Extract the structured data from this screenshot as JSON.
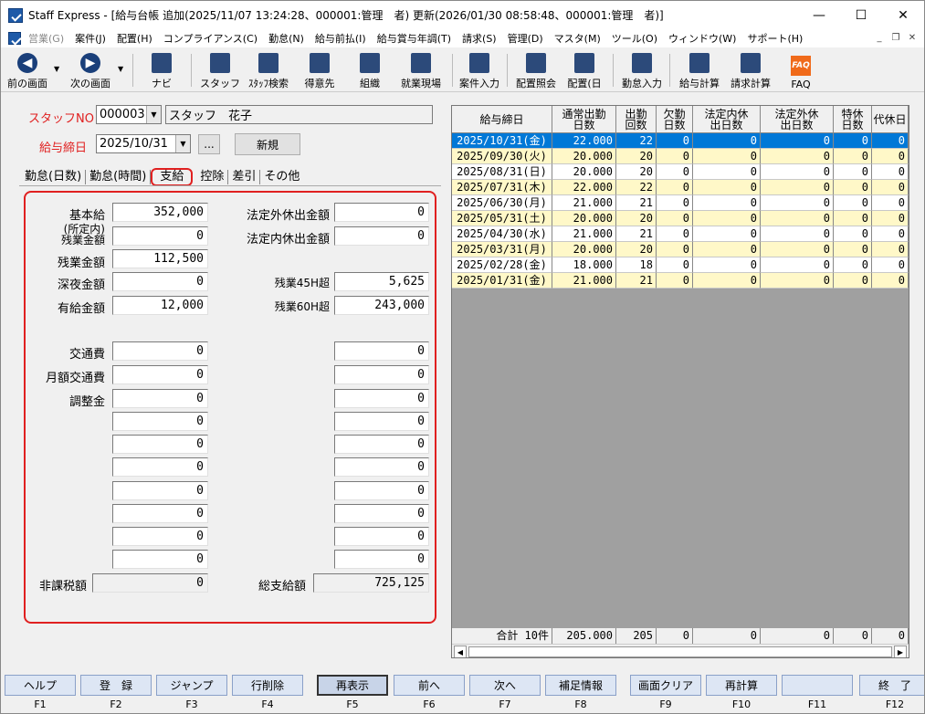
{
  "window": {
    "title": "Staff Express - [給与台帳 追加(2025/11/07 13:24:28、000001:管理　者) 更新(2026/01/30 08:58:48、000001:管理　者)]",
    "min": "—",
    "max": "☐",
    "close": "✕"
  },
  "menu": [
    "営業(G)",
    "案件(J)",
    "配置(H)",
    "コンプライアンス(C)",
    "勤怠(N)",
    "給与前払(I)",
    "給与賞与年調(T)",
    "請求(S)",
    "管理(D)",
    "マスタ(M)",
    "ツール(O)",
    "ウィンドウ(W)",
    "サポート(H)"
  ],
  "toolbar": {
    "prev": "前の画面",
    "next": "次の画面",
    "navi": "ナビ",
    "staff": "スタッフ",
    "staff_search": "ｽﾀｯﾌ検索",
    "client": "得意先",
    "org": "組織",
    "site": "就業現場",
    "case_input": "案件入力",
    "assign_ref": "配置照会",
    "assign": "配置(日",
    "attend_input": "勤怠入力",
    "pay_calc": "給与計算",
    "bill_calc": "請求計算",
    "faq": "FAQ"
  },
  "form": {
    "staff_no_label": "スタッフNO",
    "staff_no": "000003",
    "staff_name": "スタッフ　花子",
    "pay_close_label": "給与締日",
    "pay_close_date": "2025/10/31",
    "ellipsis": "...",
    "new_button": "新規"
  },
  "tabs": [
    "勤怠(日数)",
    "勤怠(時間)",
    "支給",
    "控除",
    "差引",
    "その他"
  ],
  "pay": {
    "base_label": "基本給",
    "base": "352,000",
    "ot_in_label1": "(所定内)",
    "ot_in_label2": "残業金額",
    "ot_in": "0",
    "ot_label": "残業金額",
    "ot": "112,500",
    "night_label": "深夜金額",
    "night": "0",
    "paid_label": "有給金額",
    "paid": "12,000",
    "legal_out_label": "法定外休出金額",
    "legal_out": "0",
    "legal_in_label": "法定内休出金額",
    "legal_in": "0",
    "ot45_label": "残業45H超",
    "ot45": "5,625",
    "ot60_label": "残業60H超",
    "ot60": "243,000",
    "transport_label": "交通費",
    "transport": "0",
    "monthly_transport_label": "月額交通費",
    "monthly_transport": "0",
    "adjust_label": "調整金",
    "adjust": "0",
    "blank_left": [
      "0",
      "0",
      "0",
      "0",
      "0",
      "0",
      "0"
    ],
    "right_extra": [
      "0",
      "0",
      "0",
      "0",
      "0",
      "0",
      "0",
      "0",
      "0",
      "0"
    ],
    "nontax_label": "非課税額",
    "nontax": "0",
    "total_label": "総支給額",
    "total": "725,125"
  },
  "grid": {
    "headers": [
      "給与締日",
      "通常出勤\n日数",
      "出勤\n回数",
      "欠勤\n日数",
      "法定内休\n出日数",
      "法定外休\n出日数",
      "特休\n日数",
      "代休日"
    ],
    "rows": [
      [
        "2025/10/31(金)",
        "22.000",
        "22",
        "0",
        "0",
        "0",
        "0",
        "0"
      ],
      [
        "2025/09/30(火)",
        "20.000",
        "20",
        "0",
        "0",
        "0",
        "0",
        "0"
      ],
      [
        "2025/08/31(日)",
        "20.000",
        "20",
        "0",
        "0",
        "0",
        "0",
        "0"
      ],
      [
        "2025/07/31(木)",
        "22.000",
        "22",
        "0",
        "0",
        "0",
        "0",
        "0"
      ],
      [
        "2025/06/30(月)",
        "21.000",
        "21",
        "0",
        "0",
        "0",
        "0",
        "0"
      ],
      [
        "2025/05/31(土)",
        "20.000",
        "20",
        "0",
        "0",
        "0",
        "0",
        "0"
      ],
      [
        "2025/04/30(水)",
        "21.000",
        "21",
        "0",
        "0",
        "0",
        "0",
        "0"
      ],
      [
        "2025/03/31(月)",
        "20.000",
        "20",
        "0",
        "0",
        "0",
        "0",
        "0"
      ],
      [
        "2025/02/28(金)",
        "18.000",
        "18",
        "0",
        "0",
        "0",
        "0",
        "0"
      ],
      [
        "2025/01/31(金)",
        "21.000",
        "21",
        "0",
        "0",
        "0",
        "0",
        "0"
      ]
    ],
    "footer": [
      "合計 10件",
      "205.000",
      "205",
      "0",
      "0",
      "0",
      "0",
      "0"
    ]
  },
  "fkeys": [
    {
      "label": "ヘルプ",
      "key": "F1"
    },
    {
      "label": "登　録",
      "key": "F2"
    },
    {
      "label": "ジャンプ",
      "key": "F3"
    },
    {
      "label": "行削除",
      "key": "F4"
    },
    {
      "label": "再表示",
      "key": "F5"
    },
    {
      "label": "前へ",
      "key": "F6"
    },
    {
      "label": "次へ",
      "key": "F7"
    },
    {
      "label": "補足情報",
      "key": "F8"
    },
    {
      "label": "画面クリア",
      "key": "F9"
    },
    {
      "label": "再計算",
      "key": "F10"
    },
    {
      "label": "",
      "key": "F11"
    },
    {
      "label": "終　了",
      "key": "F12"
    }
  ],
  "colors": {
    "accent_red": "#e02020",
    "selected_row": "#0078d7",
    "yellow_row": "#fff8c8"
  }
}
